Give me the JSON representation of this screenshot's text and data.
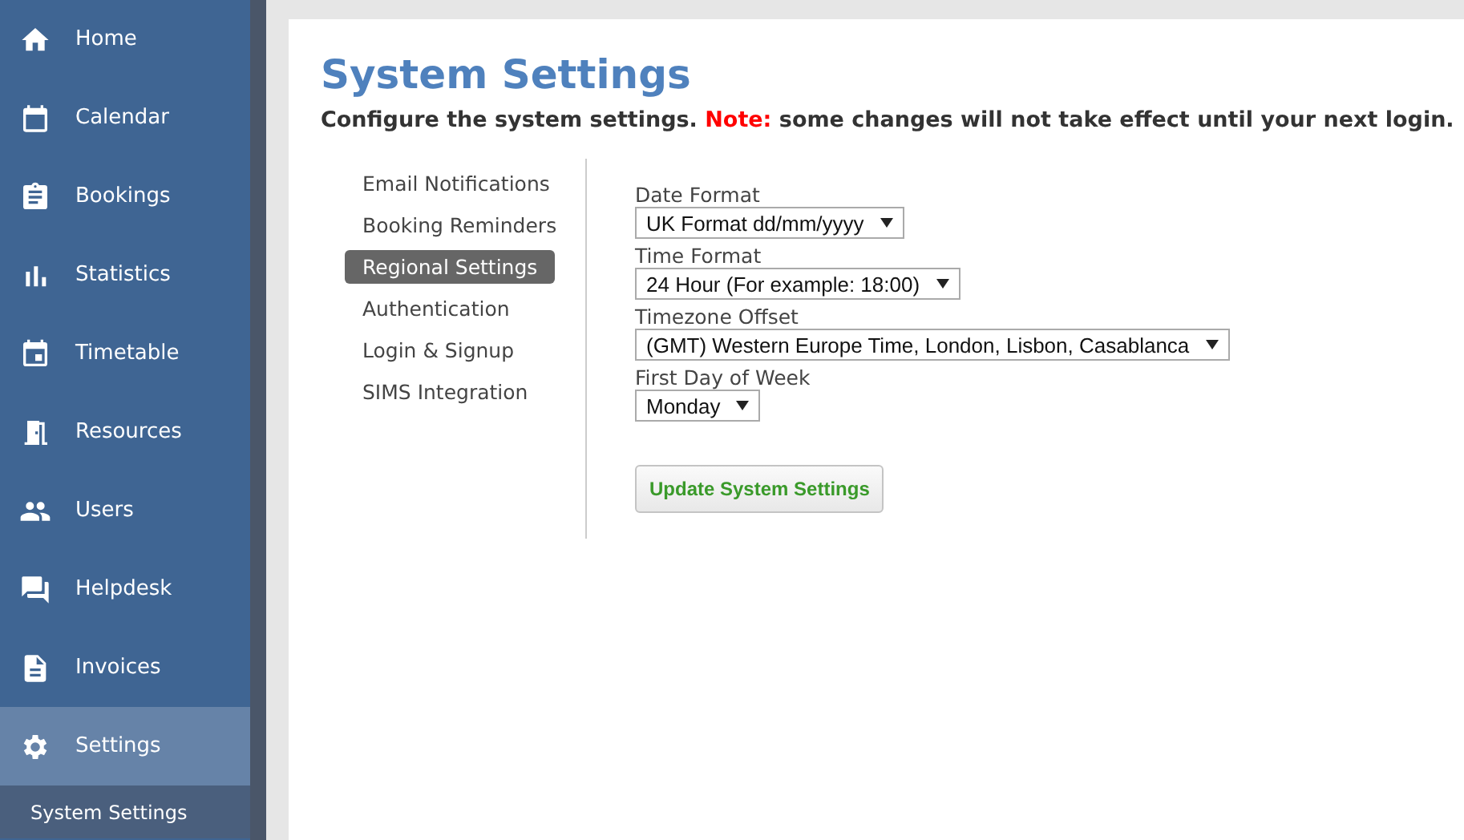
{
  "sidebar": {
    "items": [
      {
        "label": "Home",
        "kind": "home",
        "selected": false
      },
      {
        "label": "Calendar",
        "kind": "calendar",
        "selected": false
      },
      {
        "label": "Bookings",
        "kind": "clipboard",
        "selected": false
      },
      {
        "label": "Statistics",
        "kind": "bars",
        "selected": false
      },
      {
        "label": "Timetable",
        "kind": "event",
        "selected": false
      },
      {
        "label": "Resources",
        "kind": "door",
        "selected": false
      },
      {
        "label": "Users",
        "kind": "people",
        "selected": false
      },
      {
        "label": "Helpdesk",
        "kind": "chat",
        "selected": false
      },
      {
        "label": "Invoices",
        "kind": "document",
        "selected": false
      },
      {
        "label": "Settings",
        "kind": "gear",
        "selected": true,
        "children": [
          {
            "label": "System Settings",
            "selected": true
          }
        ]
      }
    ]
  },
  "page": {
    "title": "System Settings",
    "intro": "Configure the system settings.",
    "note_label": "Note:",
    "note_text": "some changes will not take effect until your next login."
  },
  "settings_menu": [
    {
      "label": "Email Notifications",
      "selected": false
    },
    {
      "label": "Booking Reminders",
      "selected": false
    },
    {
      "label": "Regional Settings",
      "selected": true
    },
    {
      "label": "Authentication",
      "selected": false
    },
    {
      "label": "Login & Signup",
      "selected": false
    },
    {
      "label": "SIMS Integration",
      "selected": false
    }
  ],
  "fields": [
    {
      "label": "Date Format",
      "value": "UK Format dd/mm/yyyy"
    },
    {
      "label": "Time Format",
      "value": "24 Hour (For example: 18:00)"
    },
    {
      "label": "Timezone Offset",
      "value": "(GMT) Western Europe Time, London, Lisbon, Casablanca"
    },
    {
      "label": "First Day of Week",
      "value": "Monday"
    }
  ],
  "submit_button": "Update System Settings"
}
